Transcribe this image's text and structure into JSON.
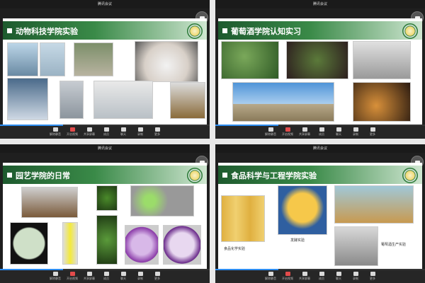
{
  "window_title": "腾讯会议",
  "panes": [
    {
      "title": "动物科技学院实验"
    },
    {
      "title": "葡萄酒学院认知实习"
    },
    {
      "title": "园艺学院的日常"
    },
    {
      "title": "食品科学与工程学院实验",
      "captions": [
        "发酵实验",
        "葡萄酒生产实验",
        "食品化学实验"
      ]
    }
  ],
  "toolbar": [
    "解除静音",
    "开启视频",
    "共享屏幕",
    "成员",
    "聊天",
    "录制",
    "更多"
  ],
  "colors": {
    "banner_dark": "#1d5a2e",
    "banner_mid": "#3a8a48",
    "accent": "#2d8cf0"
  },
  "progress": 0.3
}
